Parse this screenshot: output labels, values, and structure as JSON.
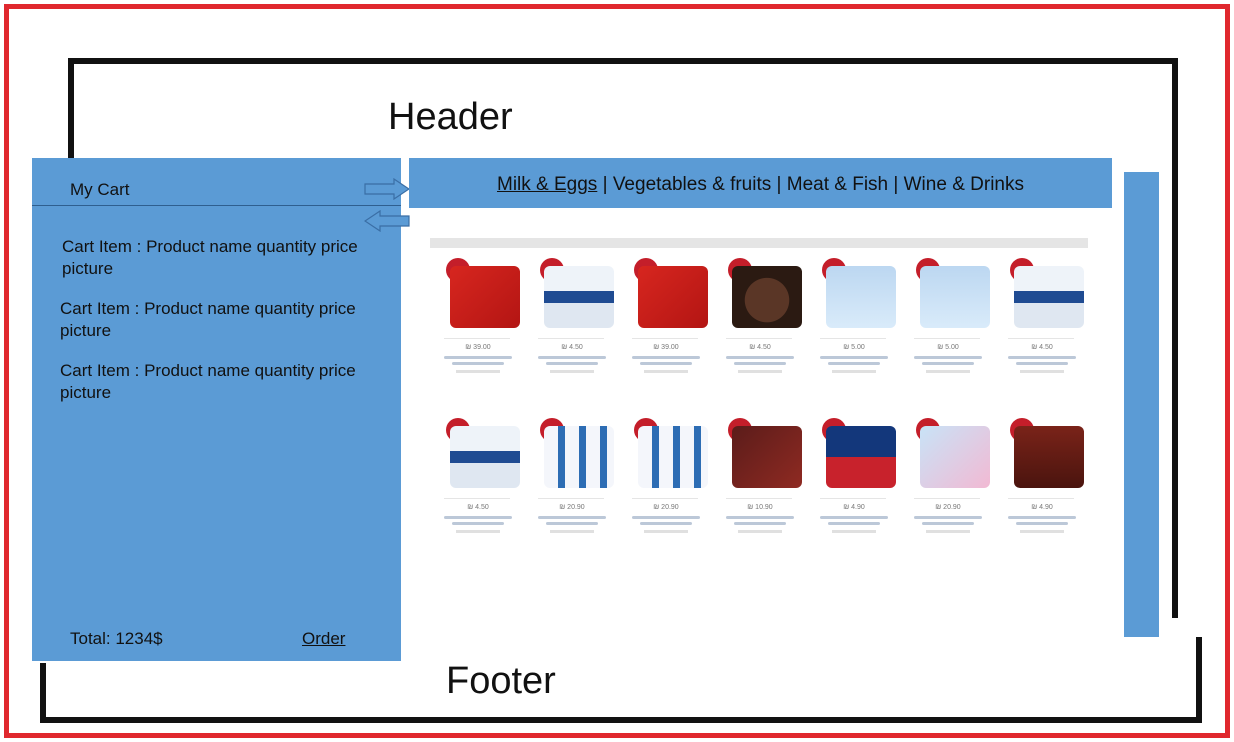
{
  "header": {
    "label": "Header"
  },
  "footer": {
    "label": "Footer"
  },
  "cart": {
    "title": "My Cart",
    "items": [
      "Cart Item : Product name quantity price picture",
      "Cart Item : Product name quantity price picture",
      "Cart Item : Product name quantity price picture"
    ],
    "total": "Total: 1234$",
    "order_label": "Order"
  },
  "nav": {
    "categories": [
      "Milk & Eggs",
      "Vegetables & fruits",
      "Meat & Fish",
      "Wine & Drinks"
    ],
    "separator": "|"
  },
  "products": {
    "row1": [
      {
        "image": "red-dessert-box",
        "price": "₪ 39.00"
      },
      {
        "image": "yogurt-cup",
        "price": "₪ 4.50"
      },
      {
        "image": "red-dessert-box",
        "price": "₪ 39.00"
      },
      {
        "image": "yolo-cup",
        "price": "₪ 4.50"
      },
      {
        "image": "snack-bag",
        "price": "₪ 5.00"
      },
      {
        "image": "snack-bag",
        "price": "₪ 5.00"
      },
      {
        "image": "yogurt-cup",
        "price": "₪ 4.50"
      }
    ],
    "row2": [
      {
        "image": "yogurt-cup",
        "price": "₪ 4.50"
      },
      {
        "image": "drink-bottles-pack",
        "price": "₪ 20.90"
      },
      {
        "image": "drink-bottles-pack",
        "price": "₪ 20.90"
      },
      {
        "image": "chocolate-dessert",
        "price": "₪ 10.90"
      },
      {
        "image": "pro-yogurt",
        "price": "₪ 4.90"
      },
      {
        "image": "kids-drinks-pack",
        "price": "₪ 20.90"
      },
      {
        "image": "yolo-cup",
        "price": "₪ 4.90"
      }
    ]
  },
  "colors": {
    "panel_blue": "#5b9bd5",
    "frame_red": "#e0282e",
    "frame_black": "#111111",
    "sale_badge": "#c41e2a"
  }
}
